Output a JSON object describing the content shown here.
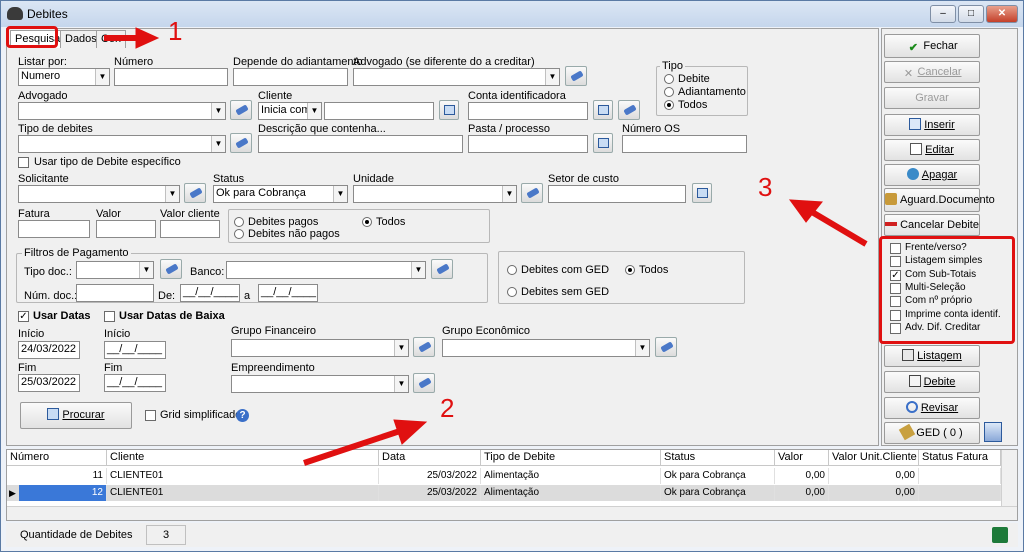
{
  "window": {
    "title": "Debites",
    "btn_min": "–",
    "btn_max": "□",
    "btn_close": "✕"
  },
  "tabs": [
    "Pesquisa",
    "Dados",
    "Con"
  ],
  "annotations": [
    "1",
    "2",
    "3"
  ],
  "form": {
    "listar_por_label": "Listar por:",
    "listar_por_value": "Numero",
    "numero_label": "Número",
    "numero_value": "",
    "depende_label": "Depende do adiantamento",
    "depende_value": "",
    "advogado_credit_label": "Advogado  (se diferente do a creditar)",
    "advogado_credit_value": "",
    "tipo_label": "Tipo",
    "tipo_options": [
      "Debite",
      "Adiantamento",
      "Todos"
    ],
    "tipo_selected": "Todos",
    "advogado_label": "Advogado",
    "advogado_value": "",
    "cliente_label": "Cliente",
    "cliente_mode": "Inicia com",
    "cliente_value": "",
    "conta_label": "Conta identificadora",
    "conta_value": "",
    "tipo_debites_label": "Tipo de debites",
    "tipo_debites_value": "",
    "descricao_label": "Descrição que contenha...",
    "descricao_value": "",
    "pasta_label": "Pasta / processo",
    "pasta_value": "",
    "numero_os_label": "Número OS",
    "numero_os_value": "",
    "usar_tipo_label": "Usar tipo de Debite específico",
    "solicitante_label": "Solicitante",
    "solicitante_value": "",
    "status_label": "Status",
    "status_value": "Ok para Cobrança",
    "unidade_label": "Unidade",
    "unidade_value": "",
    "setor_label": "Setor de custo",
    "setor_value": "",
    "fatura_label": "Fatura",
    "valor_label": "Valor",
    "valor_cliente_label": "Valor cliente",
    "pagos_options": [
      "Debites pagos",
      "Debites não pagos",
      "Todos"
    ],
    "pagos_selected": "Todos",
    "filtros_label": "Filtros de Pagamento",
    "tipo_doc_label": "Tipo doc.:",
    "banco_label": "Banco:",
    "num_doc_label": "Núm. doc.:",
    "de_label": "De:",
    "a_label": "a",
    "date_placeholder": "__/__/____",
    "ged_options": [
      "Debites com GED",
      "Debites sem GED",
      "Todos"
    ],
    "ged_selected": "Todos",
    "usar_datas_label": "Usar Datas",
    "usar_datas_baixa_label": "Usar Datas de Baixa",
    "inicio_label": "Início",
    "inicio_value": "24/03/2022",
    "inicio2_value": "__/__/____",
    "fim_label": "Fim",
    "fim_value": "25/03/2022",
    "fim2_value": "__/__/____",
    "grupo_fin_label": "Grupo Financeiro",
    "grupo_eco_label": "Grupo Econômico",
    "empreend_label": "Empreendimento",
    "procurar_label": "Procurar",
    "grid_simpl_label": "Grid simplificado",
    "help": "?"
  },
  "side": {
    "fechar": "Fechar",
    "cancelar": "Cancelar",
    "gravar": "Gravar",
    "inserir": "Inserir",
    "editar": "Editar",
    "apagar": "Apagar",
    "aguard": "Aguard.Documento",
    "cancelar_debite": "Cancelar Debite",
    "options": [
      {
        "label": "Frente/verso?",
        "checked": false
      },
      {
        "label": "Listagem simples",
        "checked": false
      },
      {
        "label": "Com Sub-Totais",
        "checked": true
      },
      {
        "label": "Multi-Seleção",
        "checked": false
      },
      {
        "label": "Com nº próprio",
        "checked": false
      },
      {
        "label": "Imprime conta identif.",
        "checked": false
      },
      {
        "label": "Adv. Dif. Creditar",
        "checked": false
      }
    ],
    "listagem": "Listagem",
    "debite": "Debite",
    "revisar": "Revisar",
    "ged": "GED ( 0 )"
  },
  "grid": {
    "headers": [
      "Número",
      "Cliente",
      "Data",
      "Tipo de Debite",
      "Status",
      "Valor",
      "Valor Unit.Cliente",
      "Status Fatura"
    ],
    "rows": [
      [
        "11",
        "CLIENTE01",
        "25/03/2022",
        "Alimentação",
        "Ok para Cobrança",
        "0,00",
        "0,00",
        ""
      ],
      [
        "12",
        "CLIENTE01",
        "25/03/2022",
        "Alimentação",
        "Ok para Cobrança",
        "0,00",
        "0,00",
        ""
      ]
    ]
  },
  "status": {
    "label": "Quantidade de Debites",
    "count": "3"
  },
  "colors": {
    "accent": "#e01010",
    "selected_row": "#3a78d8"
  }
}
